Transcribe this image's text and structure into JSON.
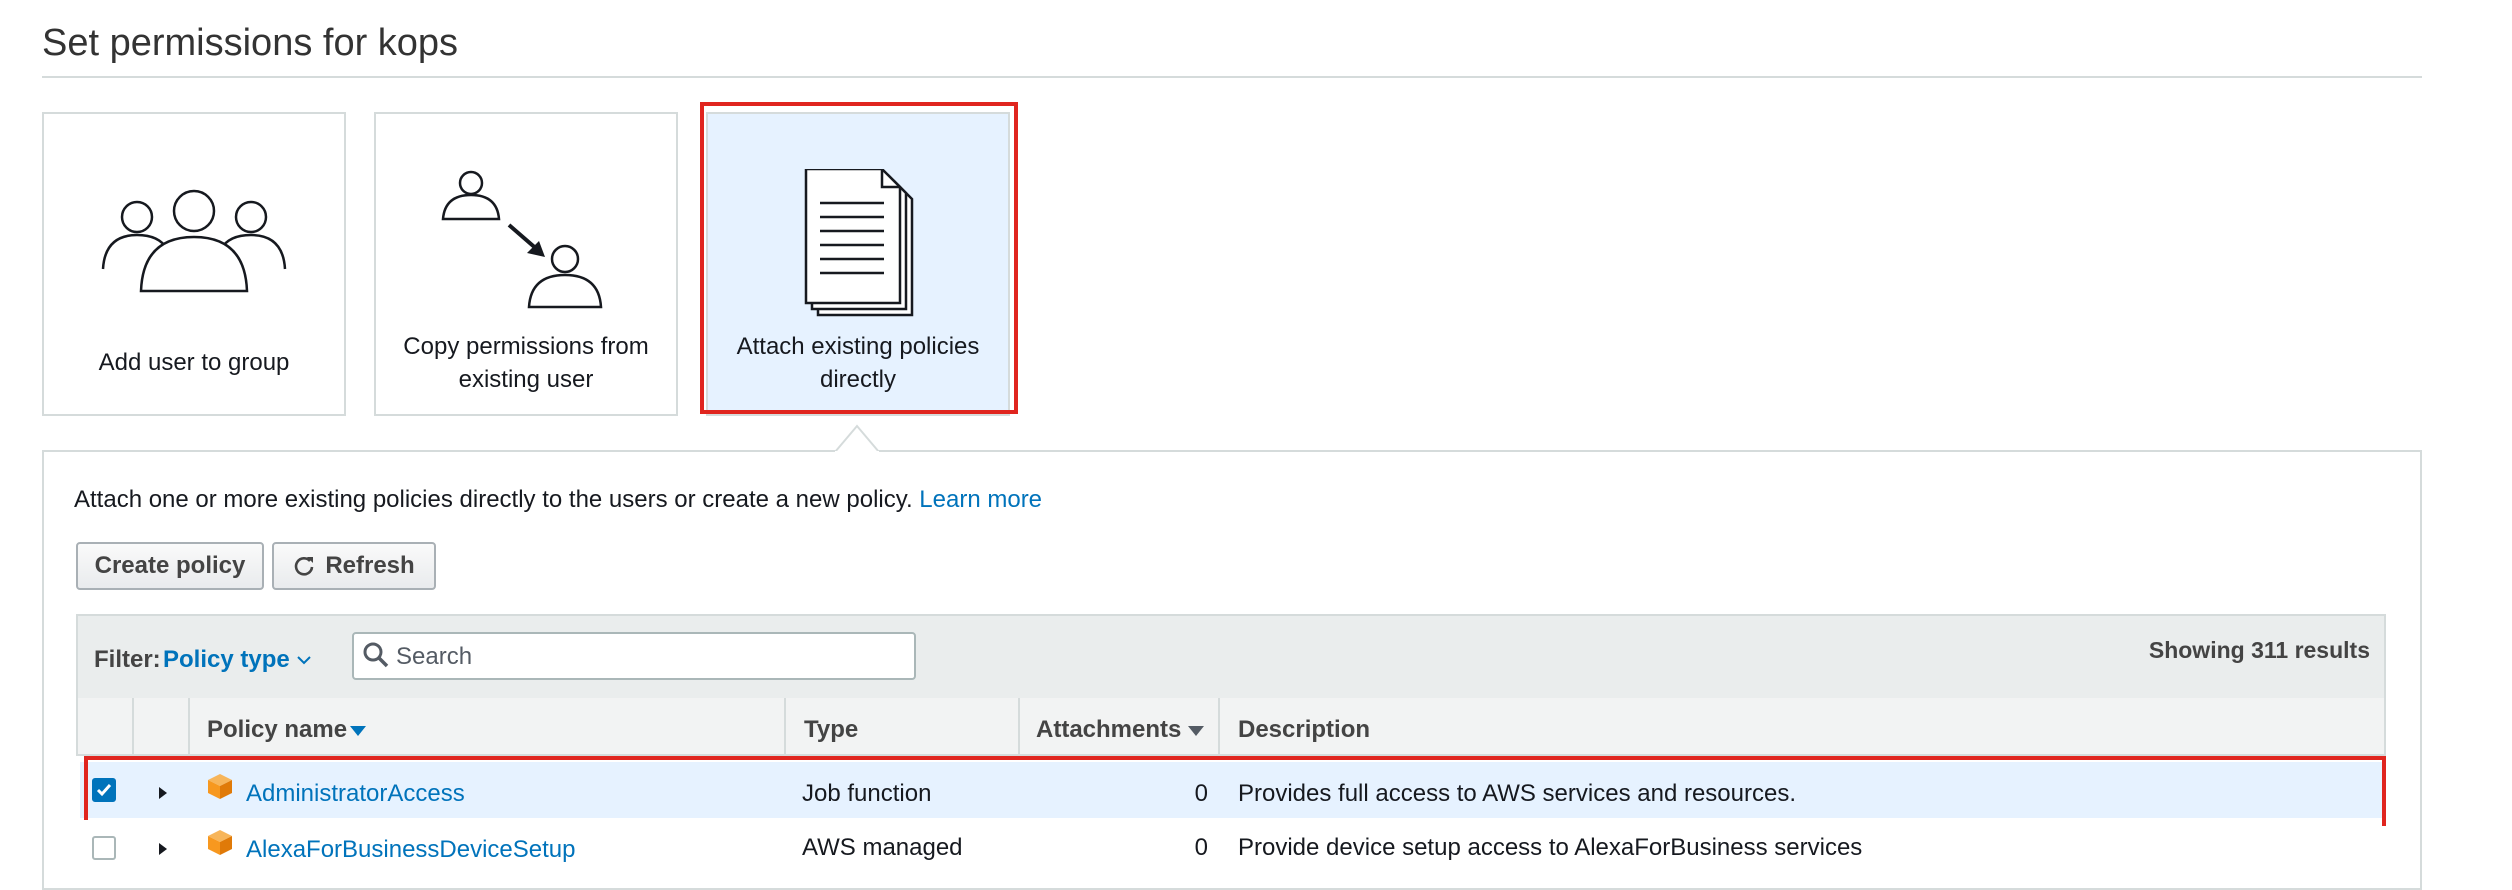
{
  "page": {
    "title": "Set permissions for kops"
  },
  "options": [
    {
      "label": "Add user to group",
      "icon": "users-group-icon",
      "selected": false
    },
    {
      "label": "Copy permissions from existing user",
      "icon": "copy-user-permissions-icon",
      "selected": false
    },
    {
      "label": "Attach existing policies directly",
      "icon": "policy-document-icon",
      "selected": true
    }
  ],
  "panel": {
    "intro_text": "Attach one or more existing policies directly to the users or create a new policy.",
    "learn_more": "Learn more"
  },
  "toolbar": {
    "create_policy": "Create policy",
    "refresh": "Refresh"
  },
  "filter": {
    "label": "Filter:",
    "value": "Policy type",
    "search_placeholder": "Search",
    "results_count": "Showing 311 results"
  },
  "table": {
    "columns": [
      "Policy name",
      "Type",
      "Attachments",
      "Description"
    ],
    "rows": [
      {
        "checked": true,
        "name": "AdministratorAccess",
        "type": "Job function",
        "attachments": "0",
        "description": "Provides full access to AWS services and resources."
      },
      {
        "checked": false,
        "name": "AlexaForBusinessDeviceSetup",
        "type": "AWS managed",
        "attachments": "0",
        "description": "Provide device setup access to AlexaForBusiness services"
      }
    ]
  },
  "colors": {
    "link": "#0073bb",
    "selected_tile_bg": "#e6f2ff",
    "highlight_outline": "#e0251f",
    "policy_icon": "#f7981f"
  }
}
